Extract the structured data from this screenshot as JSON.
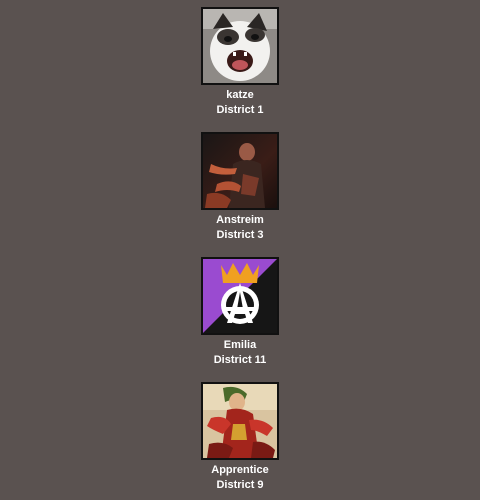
{
  "tributes": [
    {
      "name": "katze",
      "district": "District 1",
      "icon": "crying-cat-avatar"
    },
    {
      "name": "Anstreim",
      "district": "District 3",
      "icon": "armored-warrior-avatar"
    },
    {
      "name": "Emilia",
      "district": "District 11",
      "icon": "anarchy-crown-avatar",
      "colors": {
        "purple": "#9a4bd0",
        "black": "#161616",
        "crown": "#f0a020"
      }
    },
    {
      "name": "Apprentice",
      "district": "District 9",
      "icon": "red-warrior-avatar"
    }
  ]
}
